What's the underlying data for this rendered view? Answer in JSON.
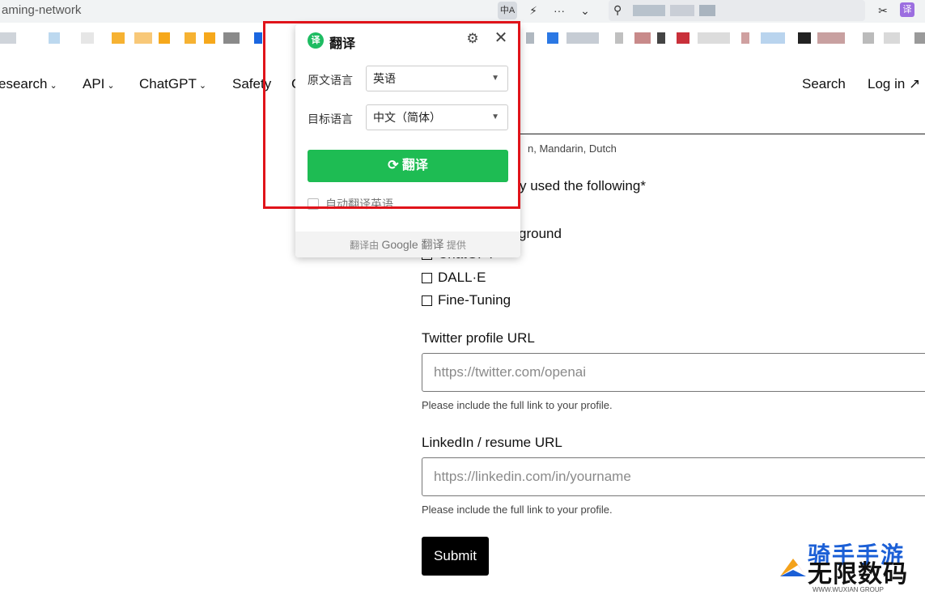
{
  "browser": {
    "url_fragment": "aming-network",
    "translate_chip": "中A",
    "ext_badge": "译"
  },
  "nav": {
    "items": [
      "esearch",
      "API",
      "ChatGPT",
      "Safety",
      "C"
    ],
    "search": "Search",
    "login": "Log in ↗"
  },
  "form": {
    "languages_hint": "n, Mandarin, Dutch",
    "used_question": "y used the following*",
    "playground_partial": "ground",
    "chatgpt_partial": "ChatGPT",
    "options": [
      "DALL·E",
      "Fine-Tuning"
    ],
    "twitter_label": "Twitter profile URL",
    "twitter_placeholder": "https://twitter.com/openai",
    "twitter_hint": "Please include the full link to your profile.",
    "linkedin_label": "LinkedIn / resume URL",
    "linkedin_placeholder": "https://linkedin.com/in/yourname",
    "linkedin_hint": "Please include the full link to your profile.",
    "submit_label": "Submit"
  },
  "translate_popup": {
    "logo_char": "译",
    "title": "翻译",
    "source_label": "原文语言",
    "source_value": "英语",
    "target_label": "目标语言",
    "target_value": "中文（简体）",
    "button_label": "翻译",
    "auto_label": "自动翻译英语",
    "footer_prefix": "翻译由",
    "footer_brand": "Google 翻译",
    "footer_suffix": "提供"
  },
  "watermark": {
    "top": "骑手手游",
    "main": "无限数码",
    "sub": "WWW.WUXIAN GROUP"
  },
  "colors": {
    "accent_green": "#1ebc53",
    "highlight_red": "#e0131a"
  }
}
